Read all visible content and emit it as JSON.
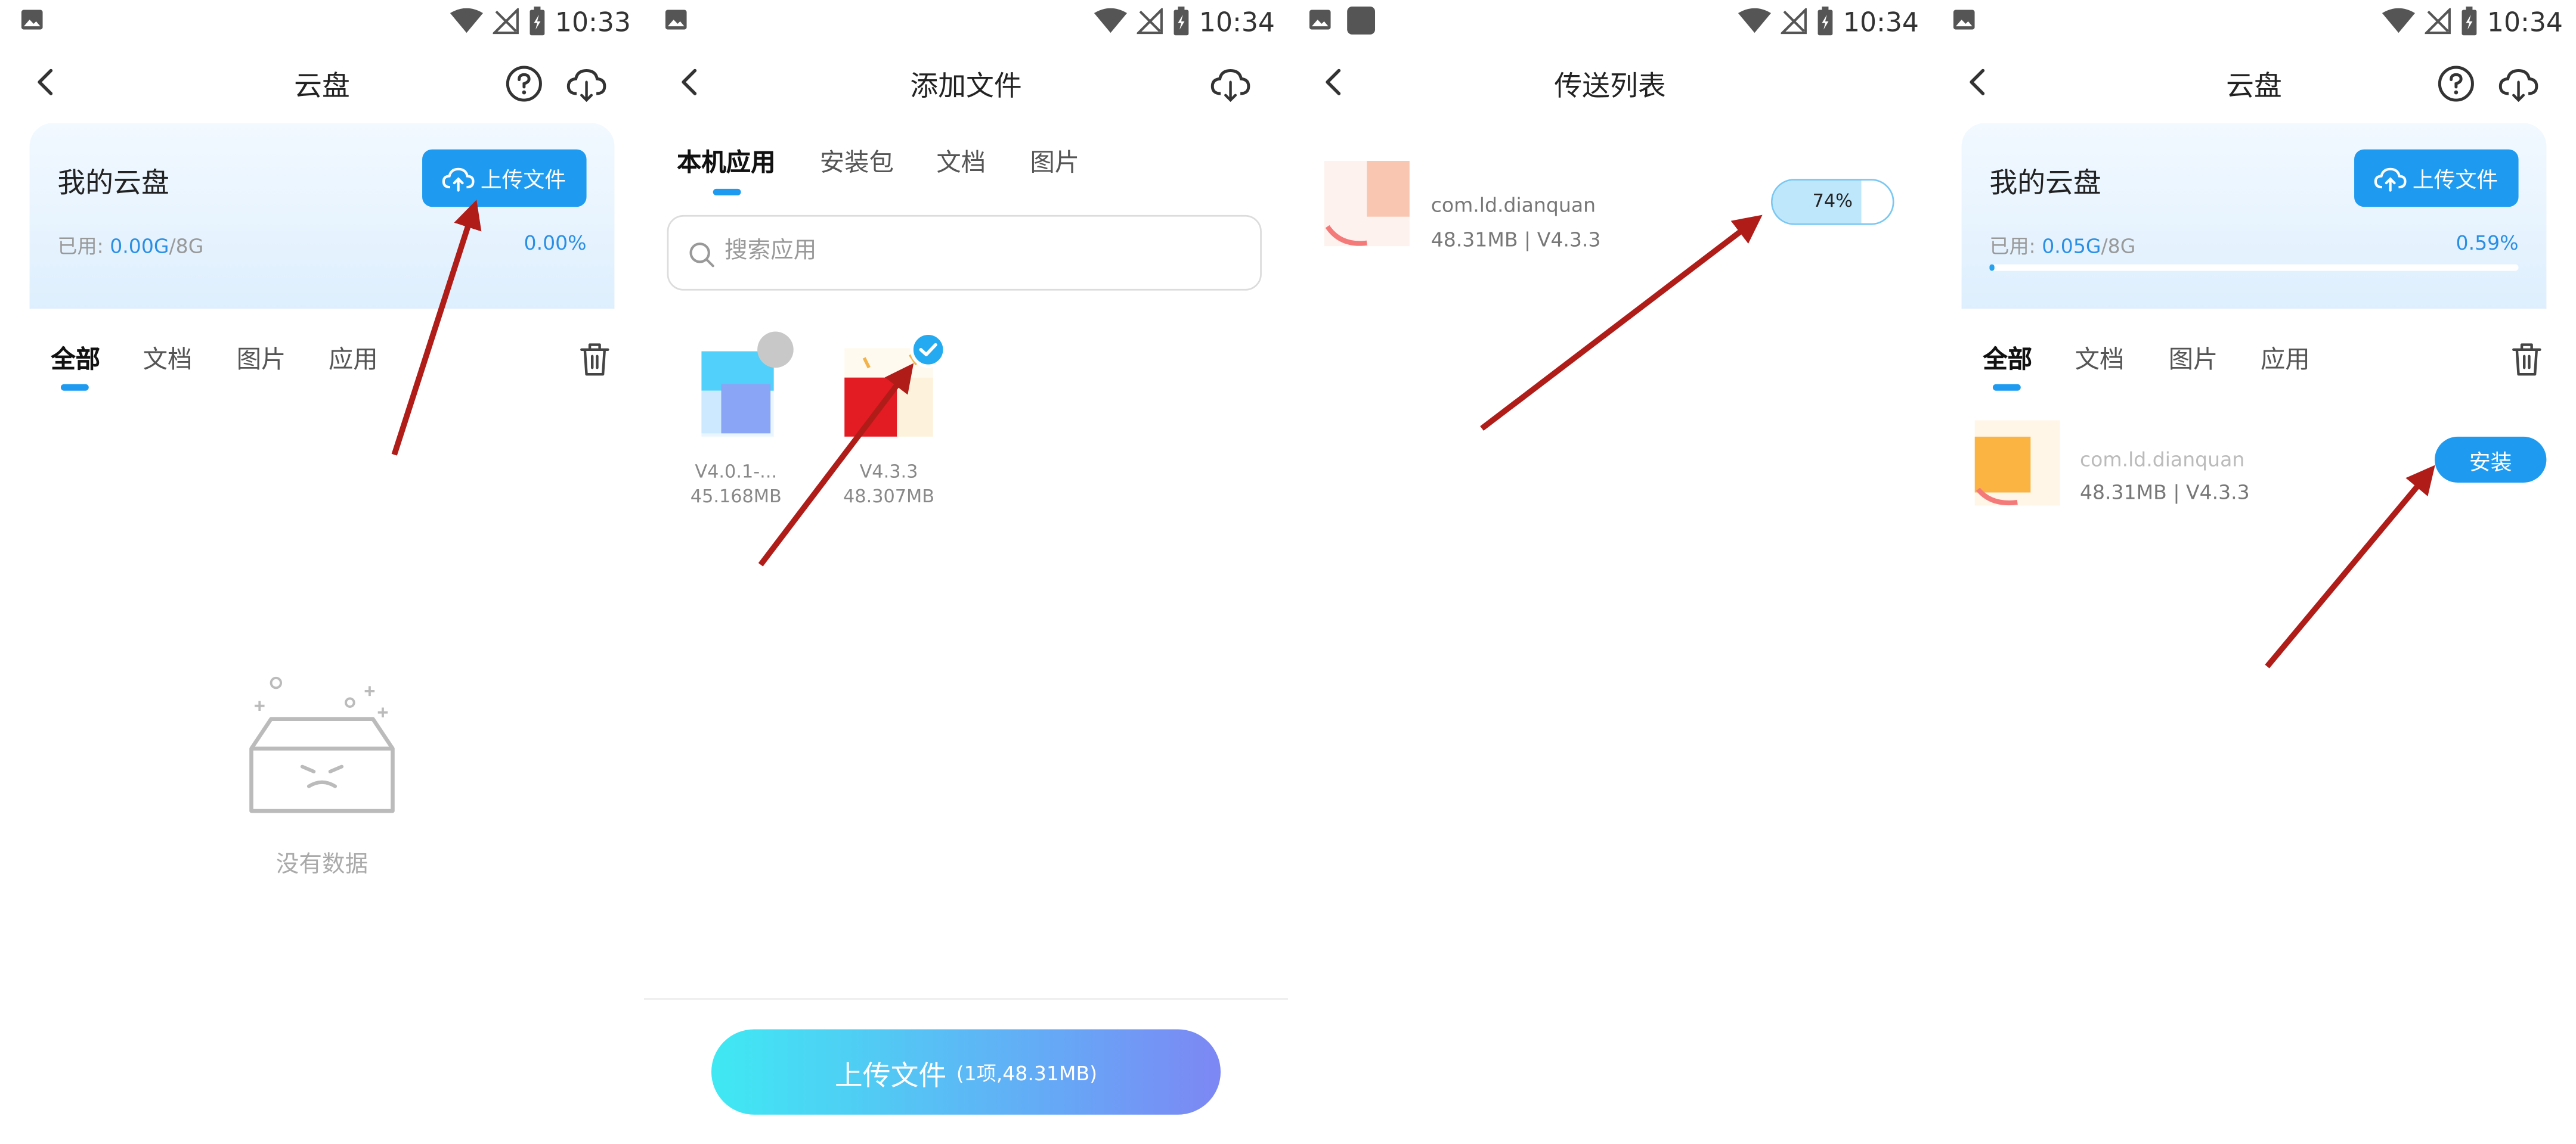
{
  "colors": {
    "accent": "#1e9bf0",
    "arrow": "#b01c18"
  },
  "screen1": {
    "status_time": "10:33",
    "title": "云盘",
    "card": {
      "title": "我的云盘",
      "upload_label": "上传文件",
      "used_label": "已用:",
      "used_value": "0.00G",
      "total": "/8G",
      "percent": "0.00%"
    },
    "tabs": [
      "全部",
      "文档",
      "图片",
      "应用"
    ],
    "empty_text": "没有数据"
  },
  "screen2": {
    "status_time": "10:34",
    "title": "添加文件",
    "tabs": [
      "本机应用",
      "安装包",
      "文档",
      "图片"
    ],
    "search_placeholder": "搜索应用",
    "apps": [
      {
        "version": "V4.0.1-...",
        "size": "45.168MB",
        "selected": false
      },
      {
        "version": "V4.3.3",
        "size": "48.307MB",
        "selected": true
      }
    ],
    "upload_button": {
      "label": "上传文件",
      "detail": "(1项,48.31MB)"
    }
  },
  "screen3": {
    "status_time": "10:34",
    "title": "传送列表",
    "file": {
      "name": "com.ld.dianquan",
      "meta": "48.31MB | V4.3.3",
      "progress_label": "74%",
      "progress": 0.74
    }
  },
  "screen4": {
    "status_time": "10:34",
    "title": "云盘",
    "card": {
      "title": "我的云盘",
      "upload_label": "上传文件",
      "used_label": "已用:",
      "used_value": "0.05G",
      "total": "/8G",
      "percent": "0.59%",
      "progress": 0.0059
    },
    "tabs": [
      "全部",
      "文档",
      "图片",
      "应用"
    ],
    "file": {
      "name": "com.ld.dianquan",
      "meta": "48.31MB | V4.3.3",
      "install_label": "安装"
    }
  }
}
